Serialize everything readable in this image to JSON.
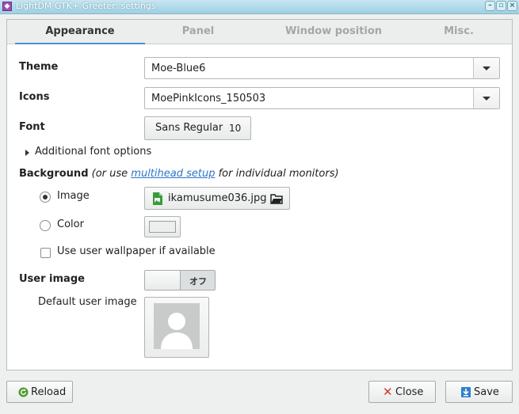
{
  "window": {
    "title": "LightDM GTK+ Greeter: settings",
    "controls": [
      "minimize",
      "maximize",
      "close"
    ]
  },
  "tabs": [
    {
      "label": "Appearance",
      "active": true
    },
    {
      "label": "Panel",
      "active": false
    },
    {
      "label": "Window position",
      "active": false
    },
    {
      "label": "Misc.",
      "active": false
    }
  ],
  "appearance": {
    "theme_label": "Theme",
    "theme_value": "Moe-Blue6",
    "icons_label": "Icons",
    "icons_value": "MoePinkIcons_150503",
    "font_label": "Font",
    "font_name": "Sans Regular",
    "font_size": "10",
    "additional_font_options": "Additional font options",
    "background_label": "Background",
    "background_note_before": "(or use ",
    "background_link": "multihead setup",
    "background_note_after": " for individual monitors)",
    "image_option": "Image",
    "image_file": "ikamusume036.jpg",
    "color_option": "Color",
    "selected_background": "Image",
    "color_swatch": "#eeeeee",
    "wallpaper_checkbox": "Use user wallpaper if available",
    "wallpaper_checked": false,
    "user_image_label": "User image",
    "user_image_switch": "オフ",
    "user_image_enabled": false,
    "default_user_image_label": "Default user image"
  },
  "footer": {
    "reload": "Reload",
    "close": "Close",
    "save": "Save"
  },
  "icons": {
    "app": "lightdm-icon",
    "reload": "reload-icon",
    "close": "close-x-icon",
    "save": "save-icon",
    "file_image": "image-file-icon",
    "open": "open-file-icon",
    "avatar": "user-avatar-icon"
  },
  "colors": {
    "titlebar": "#a9d8ea",
    "tab_indicator": "#4a90d9",
    "link": "#2a76c6",
    "close_icon": "#d6362f",
    "save_icon": "#2f7fd1",
    "reload_icon": "#4f9a2f"
  }
}
